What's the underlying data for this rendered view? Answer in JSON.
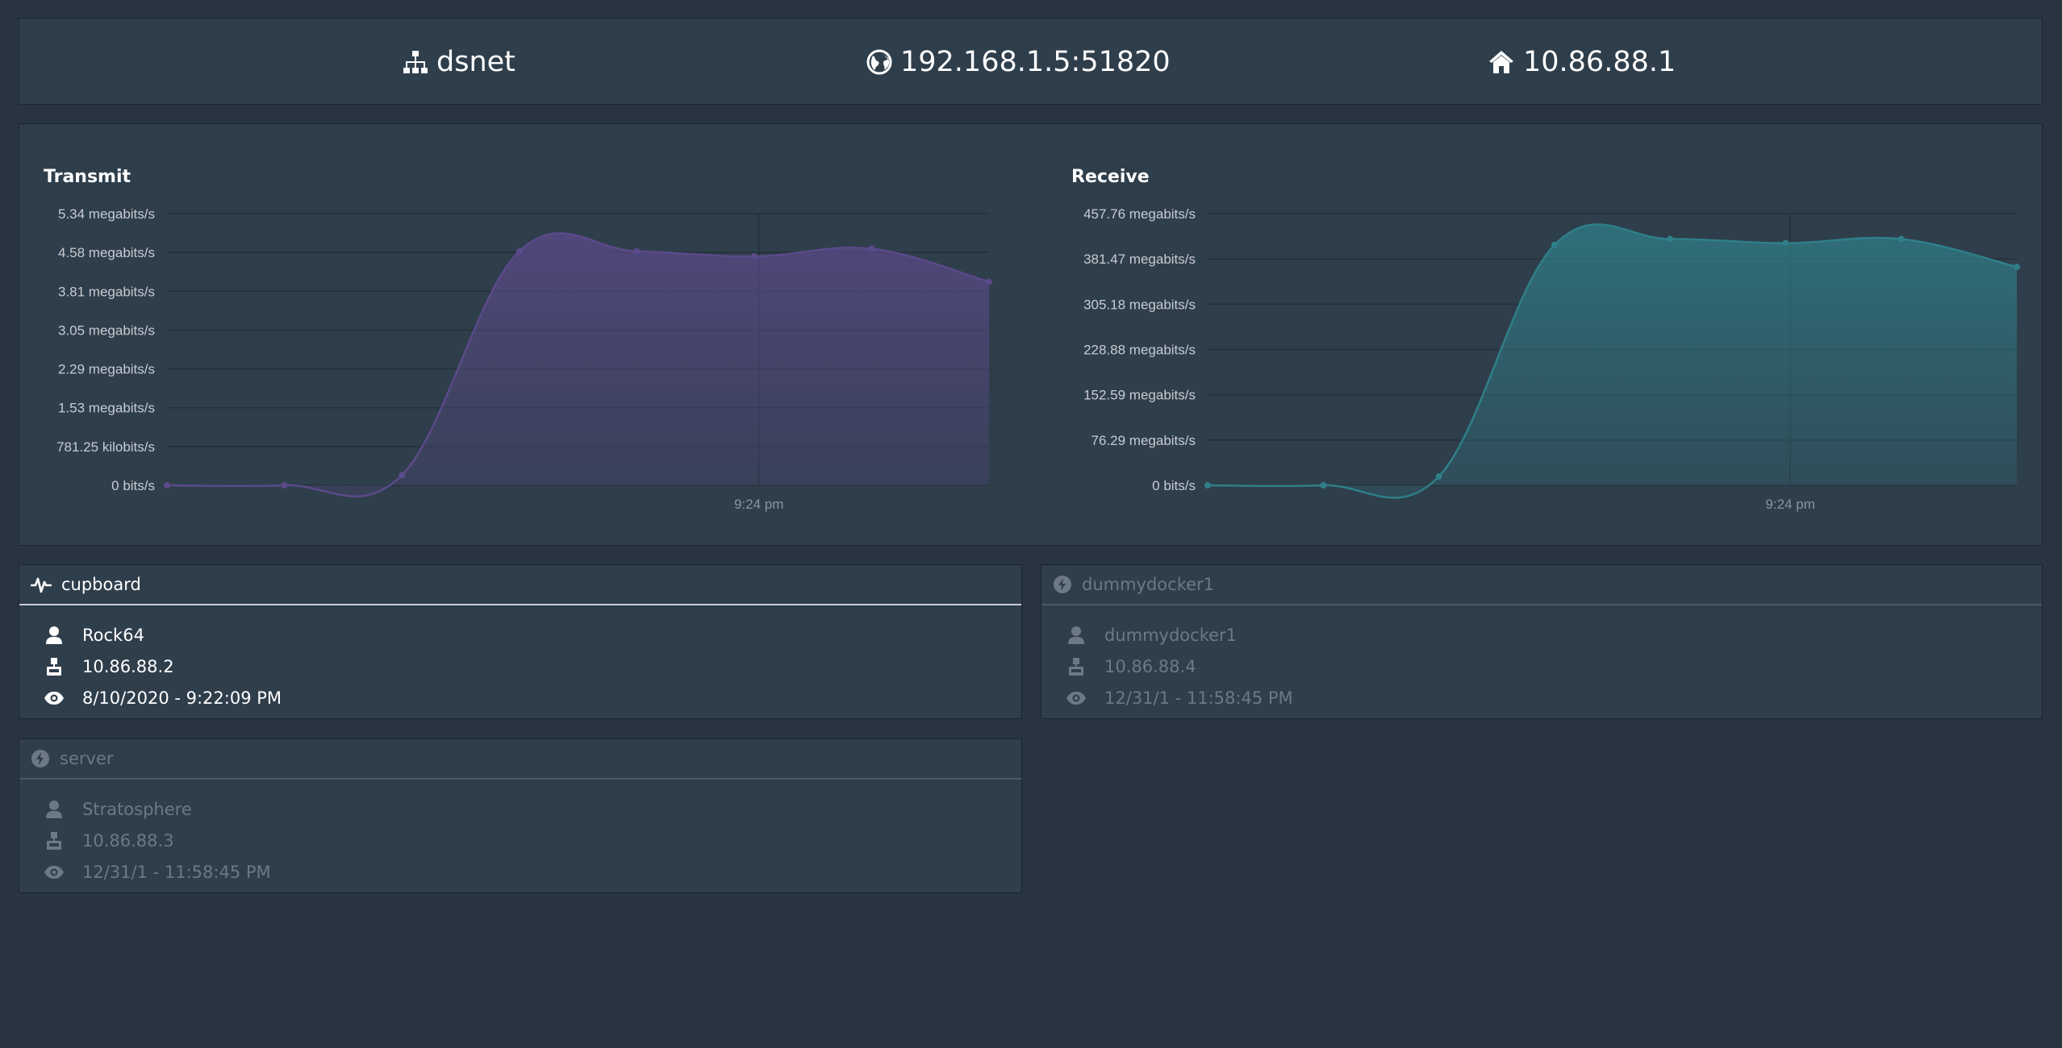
{
  "header": {
    "name": "dsnet",
    "endpoint": "192.168.1.5:51820",
    "gateway": "10.86.88.1",
    "icons": [
      "network-icon",
      "globe-icon",
      "home-icon"
    ]
  },
  "charts": [
    {
      "type": "area",
      "title": "Transmit",
      "color": "#5b4a8a",
      "y_ticks": [
        "5.34 megabits/s",
        "4.58 megabits/s",
        "3.81 megabits/s",
        "3.05 megabits/s",
        "2.29 megabits/s",
        "1.53 megabits/s",
        "781.25 kilobits/s",
        "0 bits/s"
      ],
      "x_ticks": [
        "9:24 pm"
      ],
      "ylim": [
        0,
        5.34
      ],
      "y_unit": "megabits/s",
      "values": [
        0,
        0,
        0.2,
        4.6,
        4.6,
        4.5,
        4.65,
        4.0
      ]
    },
    {
      "type": "area",
      "title": "Receive",
      "color": "#2f7f89",
      "y_ticks": [
        "457.76 megabits/s",
        "381.47 megabits/s",
        "305.18 megabits/s",
        "228.88 megabits/s",
        "152.59 megabits/s",
        "76.29 megabits/s",
        "0 bits/s"
      ],
      "x_ticks": [
        "9:24 pm"
      ],
      "ylim": [
        0,
        457.76
      ],
      "y_unit": "megabits/s",
      "values": [
        0,
        0,
        15,
        405,
        415,
        408,
        415,
        368
      ]
    }
  ],
  "chart_data": [
    {
      "type": "area",
      "title": "Transmit",
      "x": [
        0,
        1,
        2,
        3,
        4,
        5,
        6,
        7
      ],
      "x_tick_labels": [
        "9:24 pm"
      ],
      "y_unit": "megabits/s",
      "ylim": [
        0,
        5.34
      ],
      "values": [
        0,
        0,
        0.2,
        4.6,
        4.6,
        4.5,
        4.65,
        4.0
      ],
      "grid": true,
      "color": "#5b4a8a"
    },
    {
      "type": "area",
      "title": "Receive",
      "x": [
        0,
        1,
        2,
        3,
        4,
        5,
        6,
        7
      ],
      "x_tick_labels": [
        "9:24 pm"
      ],
      "y_unit": "megabits/s",
      "ylim": [
        0,
        457.76
      ],
      "values": [
        0,
        0,
        15,
        405,
        415,
        408,
        415,
        368
      ],
      "grid": true,
      "color": "#2f7f89"
    }
  ],
  "peers": [
    {
      "name": "cupboard",
      "status_icon": "pulse-icon",
      "active": true,
      "owner": "Rock64",
      "ip": "10.86.88.2",
      "last_seen": "8/10/2020 - 9:22:09 PM"
    },
    {
      "name": "dummydocker1",
      "status_icon": "bolt-icon",
      "active": false,
      "owner": "dummydocker1",
      "ip": "10.86.88.4",
      "last_seen": "12/31/1 - 11:58:45 PM"
    },
    {
      "name": "server",
      "status_icon": "bolt-icon",
      "active": false,
      "owner": "Stratosphere",
      "ip": "10.86.88.3",
      "last_seen": "12/31/1 - 11:58:45 PM"
    }
  ],
  "colors": {
    "background": "#283540",
    "panel": "#2f3e4b",
    "inactive_text": "#6c7983",
    "transmit": "#5b4a8a",
    "receive": "#2f7f89"
  }
}
